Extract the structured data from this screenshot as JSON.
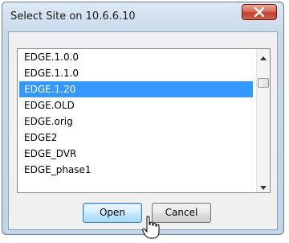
{
  "window": {
    "title": "Select Site on 10.6.6.10",
    "close_icon": "close-x-icon"
  },
  "listbox": {
    "items": [
      "EDGE.1.0.0",
      "EDGE.1.1.0",
      "EDGE.1.20",
      "EDGE.OLD",
      "EDGE.orig",
      "EDGE2",
      "EDGE_DVR",
      "EDGE_phase1"
    ],
    "selected_item": "EDGE.1.20"
  },
  "buttons": {
    "open_label": "Open",
    "cancel_label": "Cancel"
  },
  "colors": {
    "selection": "#3399ff",
    "close_button": "#c74a37"
  }
}
